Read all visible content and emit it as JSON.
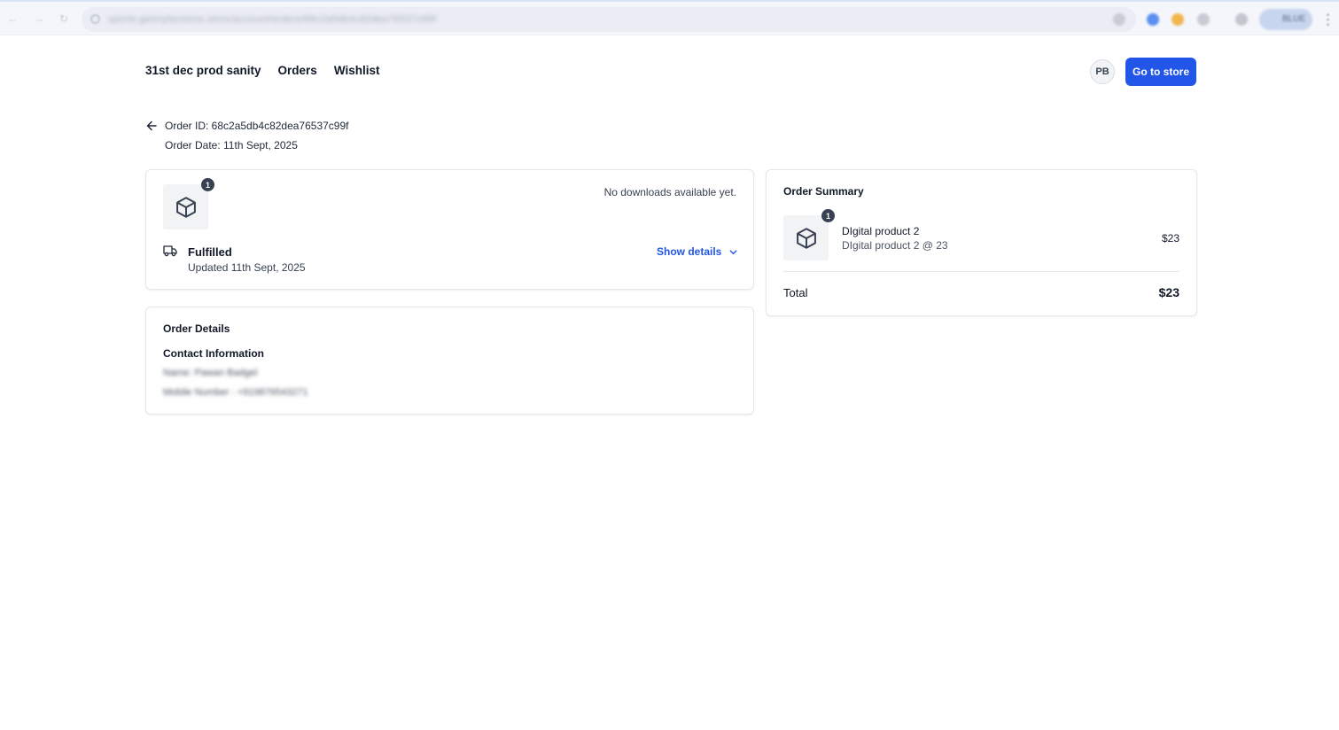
{
  "browser": {
    "url": "sports.getmyfavstore.store/account/orders/68c2a5db4c82dea76537c99f",
    "profile_label": "BLUE"
  },
  "header": {
    "store_name": "31st dec prod sanity",
    "nav": [
      "Orders",
      "Wishlist"
    ],
    "avatar_initials": "PB",
    "go_to_store_label": "Go to store"
  },
  "order": {
    "id_text": "Order ID: 68c2a5db4c82dea76537c99f",
    "date_text": "Order Date: 11th Sept, 2025"
  },
  "fulfillment": {
    "item_count": "1",
    "downloads_text": "No downloads available yet.",
    "status": "Fulfilled",
    "updated_text": "Updated 11th Sept, 2025",
    "show_details_label": "Show details"
  },
  "details": {
    "title": "Order Details",
    "contact_title": "Contact Information",
    "name_line": "Name: Pawan Badgel",
    "mobile_line": "Mobile Number : +919876543271"
  },
  "summary": {
    "title": "Order Summary",
    "item_count": "1",
    "product_name": "DIgital product 2",
    "product_sub": "DIgital product 2 @ 23",
    "product_price": "$23",
    "total_label": "Total",
    "total_value": "$23"
  },
  "colors": {
    "accent": "#2156e8",
    "badge": "#374151"
  }
}
